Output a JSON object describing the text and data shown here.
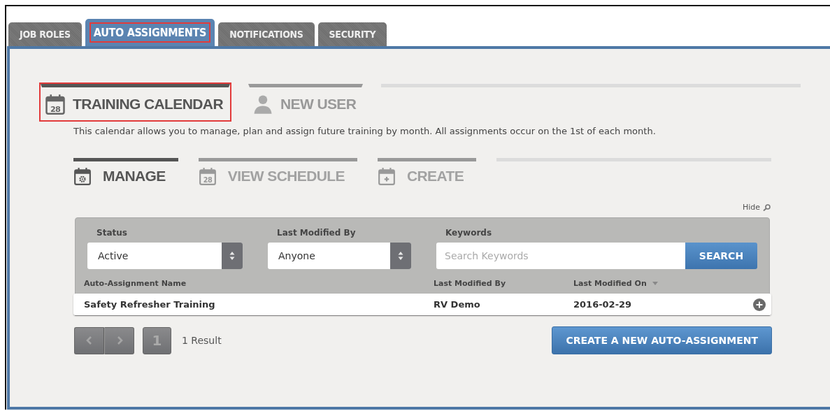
{
  "tabs": [
    {
      "label": "JOB ROLES",
      "selected": false,
      "highlighted": false
    },
    {
      "label": "AUTO ASSIGNMENTS",
      "selected": true,
      "highlighted": true
    },
    {
      "label": "NOTIFICATIONS",
      "selected": false,
      "highlighted": false
    },
    {
      "label": "SECURITY",
      "selected": false,
      "highlighted": false
    }
  ],
  "sections": [
    {
      "label": "TRAINING CALENDAR",
      "kind": "calendar-date",
      "icon_text": "28",
      "selected": true,
      "highlighted": true
    },
    {
      "label": "NEW USER",
      "kind": "user",
      "selected": false,
      "highlighted": false
    }
  ],
  "description": "This calendar allows you to manage, plan and assign future training by month. All assignments occur on the 1st of each month.",
  "subtabs": [
    {
      "label": "MANAGE",
      "kind": "calendar-gear",
      "selected": true
    },
    {
      "label": "VIEW SCHEDULE",
      "kind": "calendar-date",
      "icon_text": "28",
      "selected": false
    },
    {
      "label": "CREATE",
      "kind": "calendar-plus",
      "selected": false
    }
  ],
  "hide_link": "Hide",
  "filters": {
    "status": {
      "label": "Status",
      "value": "Active"
    },
    "modified_by": {
      "label": "Last Modified By",
      "value": "Anyone"
    },
    "keywords": {
      "label": "Keywords",
      "placeholder": "Search Keywords"
    },
    "search_button": "SEARCH"
  },
  "table": {
    "columns": [
      "Auto-Assignment Name",
      "Last Modified By",
      "Last Modified On"
    ],
    "rows": [
      {
        "cells": [
          "Safety Refresher Training",
          "RV Demo",
          "2016-02-29"
        ]
      }
    ]
  },
  "pagination": {
    "page": "1",
    "result": "1 Result"
  },
  "create_button": "CREATE A NEW AUTO-ASSIGNMENT"
}
